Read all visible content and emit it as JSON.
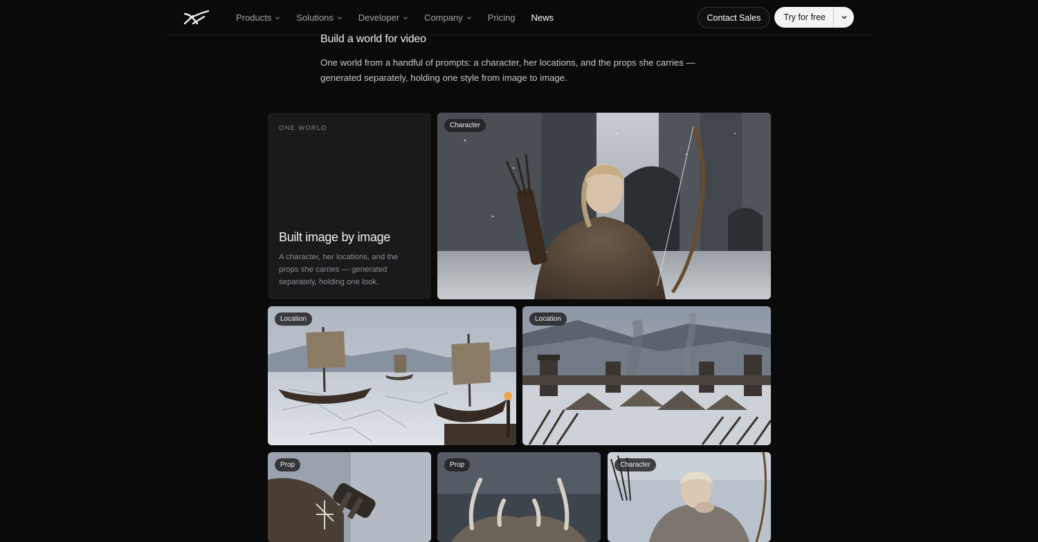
{
  "nav": {
    "logo_icon": "x-logo-icon",
    "menu": [
      {
        "label": "Products",
        "has_dropdown": true
      },
      {
        "label": "Solutions",
        "has_dropdown": true
      },
      {
        "label": "Developer",
        "has_dropdown": true
      },
      {
        "label": "Company",
        "has_dropdown": true
      },
      {
        "label": "Pricing",
        "has_dropdown": false
      },
      {
        "label": "News",
        "has_dropdown": false,
        "active": true
      }
    ],
    "contact_sales": "Contact Sales",
    "try_for_free": "Try for free"
  },
  "section": {
    "title": "Build a world for video",
    "description": "One world from a handful of prompts: a character, her locations, and the props she carries — generated separately, holding one style from image to image."
  },
  "info_card": {
    "eyebrow": "ONE WORLD",
    "title": "Built image by image",
    "body": "A character, her locations, and the props she carries — generated separately, holding one look."
  },
  "tiles": [
    {
      "badge": "Character",
      "subject": "young archer with bow and quiver in snowy castle courtyard"
    },
    {
      "badge": "Location",
      "subject": "longships in frozen harbor"
    },
    {
      "badge": "Location",
      "subject": "snowy encampment with tents and watchtowers"
    },
    {
      "badge": "Prop",
      "subject": "leather pouch with carved rune"
    },
    {
      "badge": "Prop",
      "subject": "antler horns in snow"
    },
    {
      "badge": "Character",
      "subject": "archer blowing on her hands"
    }
  ],
  "colors": {
    "background": "#0a0a0b",
    "card": "#1a1a1c",
    "text_primary": "#f2f2f3",
    "text_muted": "#8e8e93",
    "button_light": "#f4f4f5"
  }
}
